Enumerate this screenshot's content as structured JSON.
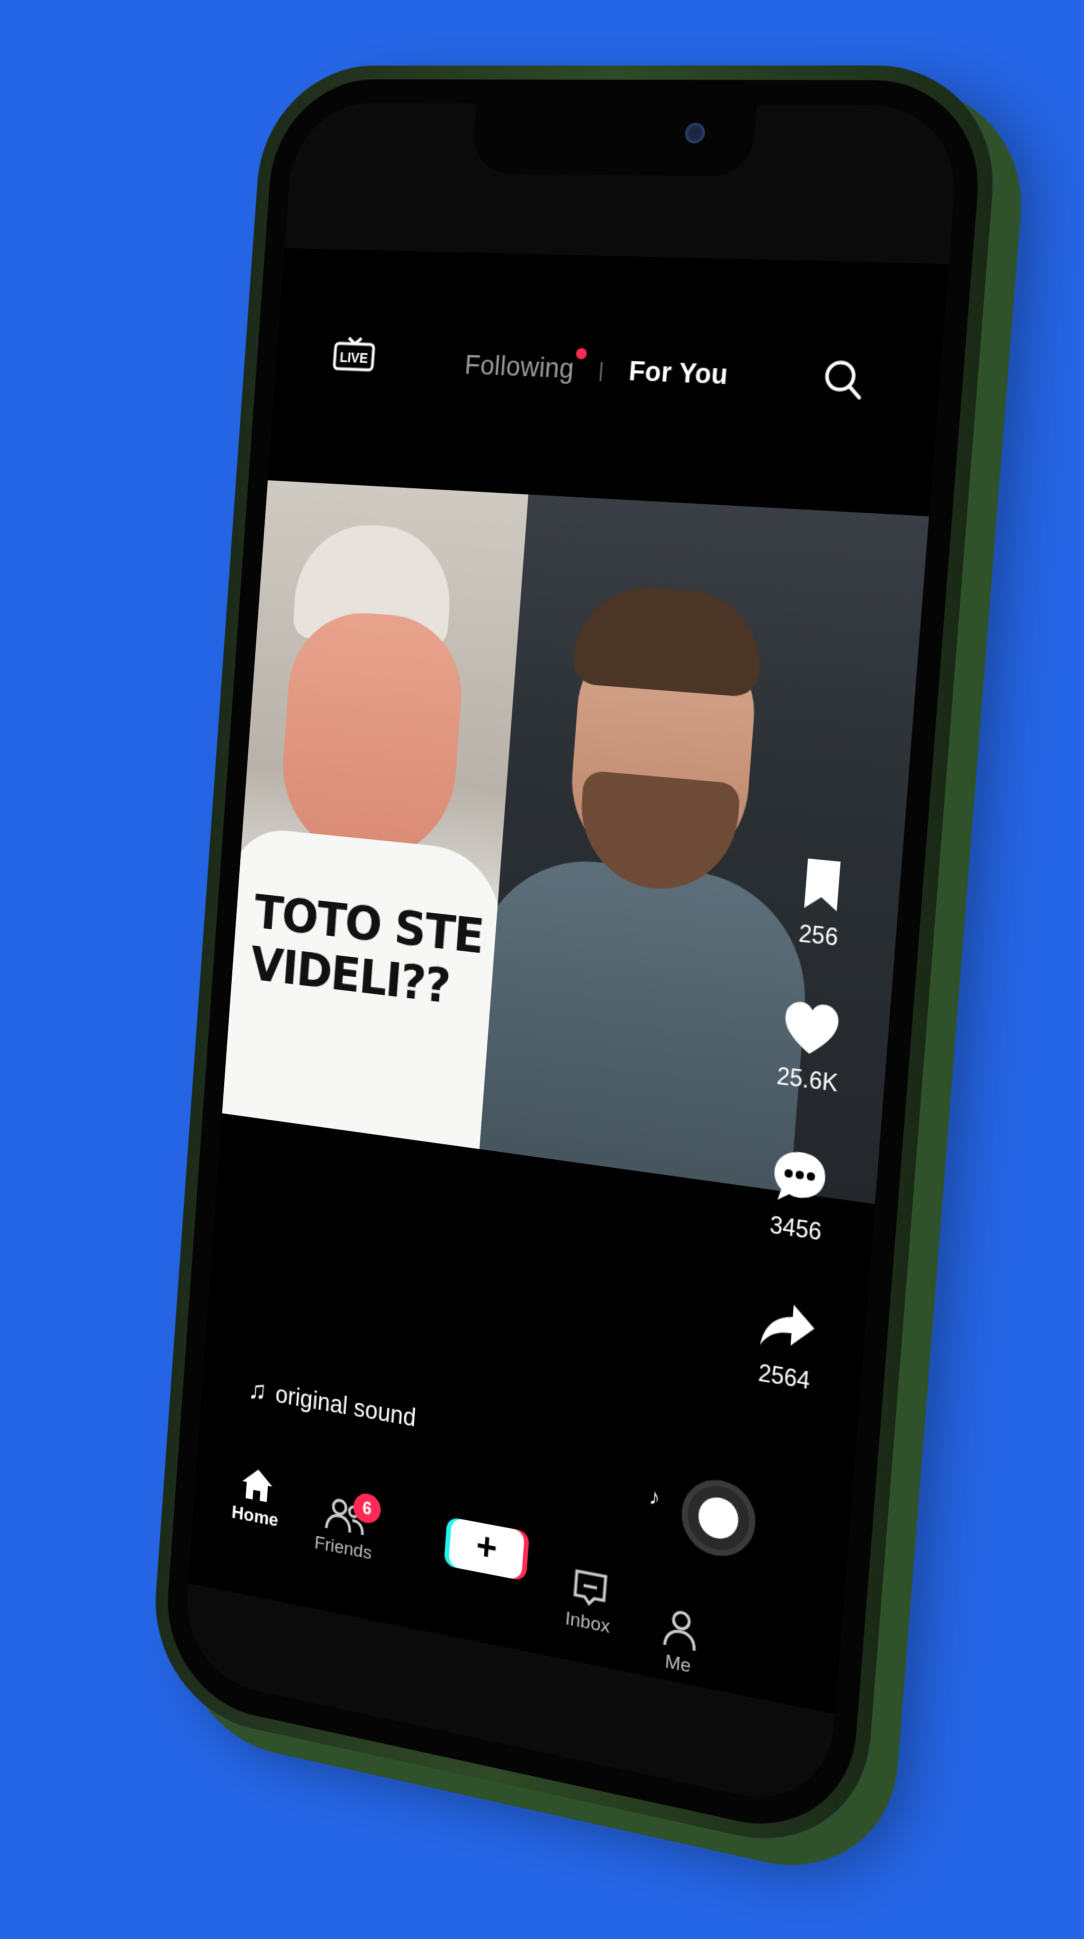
{
  "colors": {
    "background": "#2566e8",
    "phone_frame": "#2f4a27",
    "accent_red": "#ff2a55",
    "accent_cyan": "#25f4ee"
  },
  "top_bar": {
    "live_label": "LIVE",
    "tabs": {
      "following": "Following",
      "for_you": "For You"
    },
    "active_tab": "For You",
    "following_has_new": true
  },
  "video": {
    "overlay_text_line1": "TOTO STE",
    "overlay_text_line2": "VIDELI??"
  },
  "actions": {
    "save_count": "256",
    "like_count": "25.6K",
    "comment_count": "3456",
    "share_count": "2564"
  },
  "sound": {
    "label": "original sound"
  },
  "nav": {
    "home": "Home",
    "friends": "Friends",
    "friends_badge": "6",
    "create": "+",
    "inbox": "Inbox",
    "me": "Me"
  }
}
